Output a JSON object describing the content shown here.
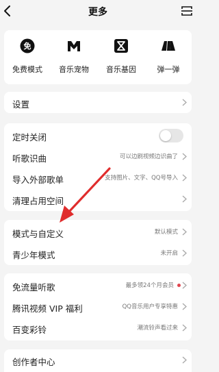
{
  "header": {
    "title": "更多"
  },
  "quick": [
    {
      "label": "免费模式",
      "icon": "free-mode-icon",
      "glyph": "免"
    },
    {
      "label": "音乐宠物",
      "icon": "music-pet-icon",
      "glyph": "M"
    },
    {
      "label": "音乐基因",
      "icon": "music-gene-icon",
      "glyph": ""
    },
    {
      "label": "弹一弹",
      "icon": "bounce-icon",
      "glyph": ""
    }
  ],
  "settings": {
    "label": "设置"
  },
  "group1": {
    "timer": {
      "label": "定时关闭",
      "enabled": false
    },
    "song_id": {
      "label": "听歌识曲",
      "value": "可以边刷视频边识曲了"
    },
    "import": {
      "label": "导入外部歌单",
      "value": "支持图片、文字、QQ号导入"
    },
    "clear": {
      "label": "清理占用空间"
    }
  },
  "group2": {
    "mode": {
      "label": "模式与自定义",
      "value": "默认模式"
    },
    "teen": {
      "label": "青少年模式",
      "value": "未开启"
    }
  },
  "group3": {
    "free_traffic": {
      "label": "免流量听歌",
      "value": "最多领24个月会员"
    },
    "tencent_vip": {
      "label": "腾讯视频 VIP 福利",
      "value": "QQ音乐用户专享特惠"
    },
    "ringtone": {
      "label": "百变彩铃",
      "value": "潮流铃声看过来"
    }
  },
  "creator": {
    "label": "创作者中心"
  },
  "colors": {
    "accent_red": "#e0454f",
    "arrow": "#e02d2d"
  }
}
